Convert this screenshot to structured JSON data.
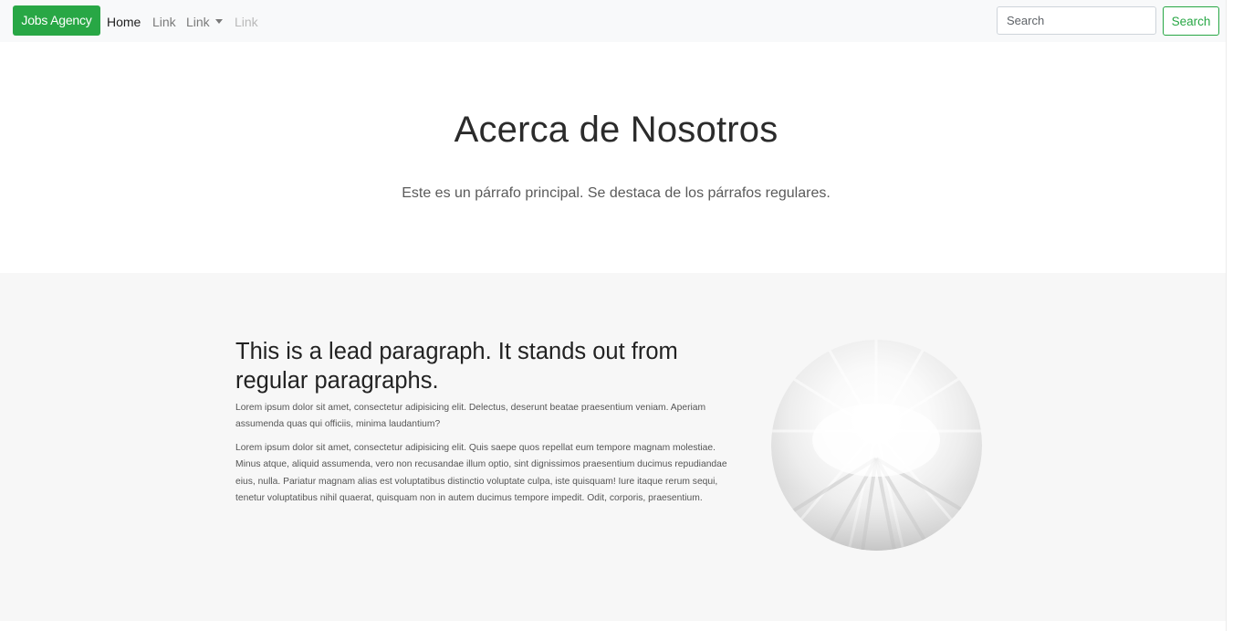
{
  "navbar": {
    "brand": "Jobs Agency",
    "links": [
      {
        "label": "Home",
        "state": "active"
      },
      {
        "label": "Link",
        "state": "normal"
      },
      {
        "label": "Link",
        "state": "dropdown"
      },
      {
        "label": "Link",
        "state": "disabled"
      }
    ],
    "search": {
      "placeholder": "Search",
      "value": "",
      "button_label": "Search"
    }
  },
  "jumbotron": {
    "title": "Acerca de Nosotros",
    "lead": "Este es un párrafo principal. Se destaca de los párrafos regulares."
  },
  "about": {
    "heading": "This is a lead paragraph. It stands out from regular paragraphs.",
    "paragraphs": [
      "Lorem ipsum dolor sit amet, consectetur adipisicing elit. Delectus, deserunt beatae praesentium veniam. Aperiam assumenda quas qui officiis, minima laudantium?",
      "Lorem ipsum dolor sit amet, consectetur adipisicing elit. Quis saepe quos repellat eum tempore magnam molestiae. Minus atque, aliquid assumenda, vero non recusandae illum optio, sint dignissimos praesentium ducimus repudiandae eius, nulla. Pariatur magnam alias est voluptatibus distinctio voluptate culpa, iste quisquam! Iure itaque rerum sequi, tenetur voluptatibus nihil quaerat, quisquam non in autem ducimus tempore impedit. Odit, corporis, praesentium."
    ],
    "image": "circular-light-rays-image"
  },
  "colors": {
    "brand_green": "#28a745",
    "navbar_bg": "#f8f9fa",
    "section_bg": "#f7f7f7"
  }
}
